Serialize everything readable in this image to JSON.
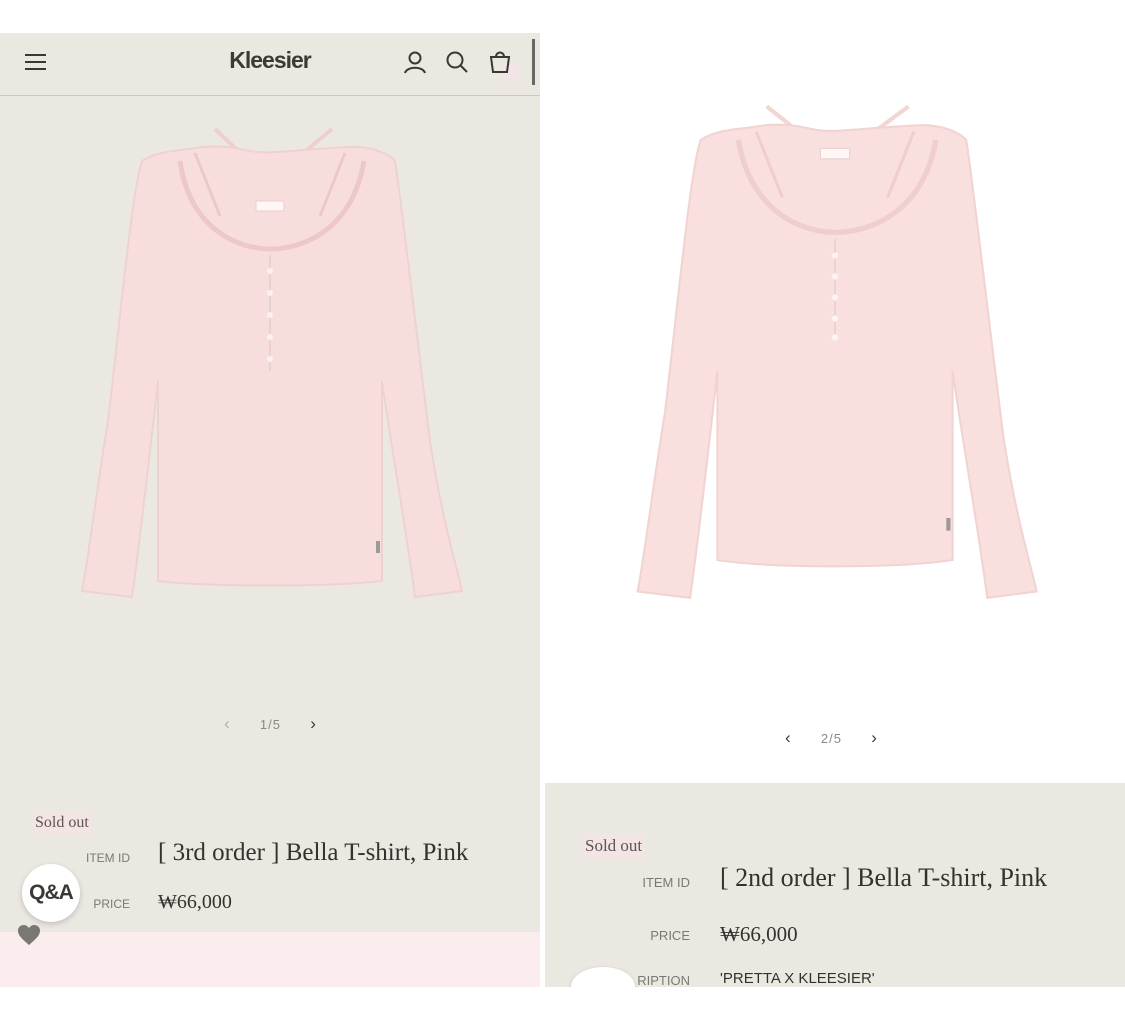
{
  "left": {
    "header": {
      "brand": "Kleesier"
    },
    "icons": [
      "menu-icon",
      "user-icon",
      "search-icon",
      "shopping-bag-icon"
    ],
    "pager": {
      "prev": "‹",
      "text": "1/5",
      "next": "›"
    },
    "product": {
      "status": "Sold out",
      "item_id_label": "ITEM ID",
      "name": "[ 3rd order ] Bella T-shirt, Pink",
      "price_label": "PRICE",
      "price": "₩66,000"
    },
    "qna_label": "Q&A",
    "colors": {
      "background": "#ebe8e2",
      "accent_pink": "#fbecee",
      "garment": "#f7dedc"
    }
  },
  "right": {
    "pager": {
      "prev": "‹",
      "text": "2/5",
      "next": "›"
    },
    "product": {
      "status": "Sold out",
      "item_id_label": "ITEM ID",
      "name": "[ 2nd order ] Bella T-shirt, Pink",
      "price_label": "PRICE",
      "price": "₩66,000",
      "description_label": "RIPTION",
      "description": "'PRETTA X KLEESIER'"
    }
  }
}
